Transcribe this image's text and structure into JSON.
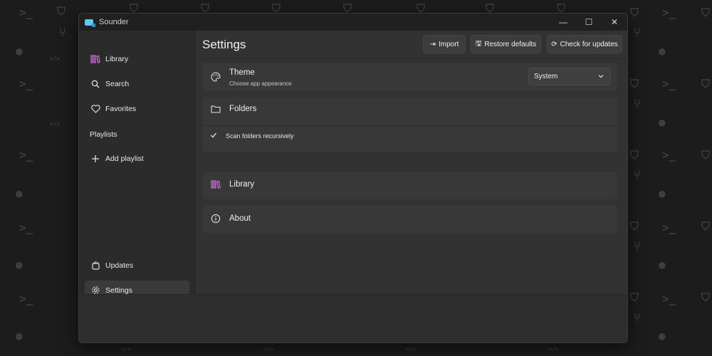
{
  "window": {
    "title": "Sounder"
  },
  "window_controls": {
    "minimize": "—",
    "maximize": "☐",
    "close": "✕"
  },
  "sidebar": {
    "items": [
      {
        "label": "Library",
        "icon": "library-icon"
      },
      {
        "label": "Search",
        "icon": "search-icon"
      },
      {
        "label": "Favorites",
        "icon": "heart-icon"
      }
    ],
    "playlists_header": "Playlists",
    "add_playlist": {
      "label": "Add playlist",
      "icon": "plus-icon"
    },
    "bottom_items": [
      {
        "label": "Updates",
        "icon": "updates-icon"
      },
      {
        "label": "Settings",
        "icon": "gear-icon",
        "active": true
      }
    ]
  },
  "page": {
    "title": "Settings",
    "toolbar": {
      "import_label": "Import",
      "restore_label": "Restore defaults",
      "check_updates_label": "Check for updates"
    }
  },
  "settings": {
    "theme": {
      "title": "Theme",
      "subtitle": "Choose app appearance",
      "value": "System"
    },
    "folders": {
      "title": "Folders",
      "recursive_label": "Scan folders recursively",
      "recursive_checked": true
    },
    "library": {
      "title": "Library"
    },
    "about": {
      "title": "About"
    }
  },
  "colors": {
    "accent": "#c86ad6",
    "window_bg": "#2b2b2b",
    "content_bg": "#323232",
    "card_bg": "#383838"
  }
}
